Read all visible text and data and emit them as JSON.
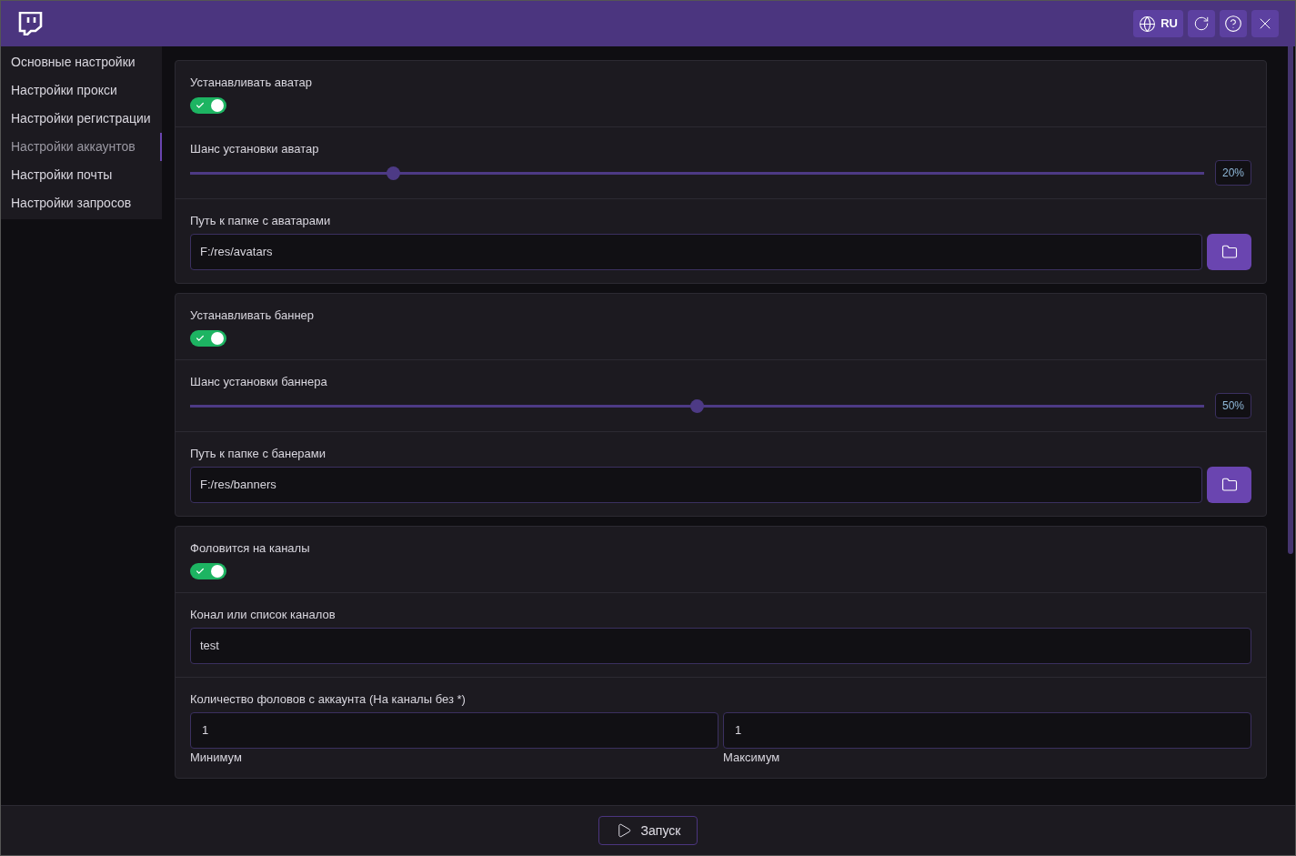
{
  "header": {
    "language": "RU"
  },
  "sidebar": {
    "items": [
      {
        "label": "Основные настройки",
        "selected": false
      },
      {
        "label": "Настройки прокси",
        "selected": false
      },
      {
        "label": "Настройки регистрации",
        "selected": false
      },
      {
        "label": "Настройки аккаунтов",
        "selected": true
      },
      {
        "label": "Настройки почты",
        "selected": false
      },
      {
        "label": "Настройки запросов",
        "selected": false
      }
    ]
  },
  "sections": [
    {
      "rows": [
        {
          "kind": "toggle",
          "label": "Устанавливать аватар",
          "on": true
        },
        {
          "kind": "slider",
          "label": "Шанс установки аватар",
          "level": 0.2,
          "reading": "20%"
        },
        {
          "kind": "path",
          "label": "Путь к папке с аватарами",
          "value": "F:/res/avatars"
        }
      ]
    },
    {
      "rows": [
        {
          "kind": "toggle",
          "label": "Устанавливать баннер",
          "on": true
        },
        {
          "kind": "slider",
          "label": "Шанс установки баннера",
          "level": 0.5,
          "reading": "50%"
        },
        {
          "kind": "path",
          "label": "Путь к папке с банерами",
          "value": "F:/res/banners"
        }
      ]
    },
    {
      "rows": [
        {
          "kind": "toggle",
          "label": "Фоловится на каналы",
          "on": true
        },
        {
          "kind": "text",
          "label": "Конал или список каналов",
          "value": "test"
        },
        {
          "kind": "range",
          "label": "Количество фоловов с аккаунта (На каналы без *)",
          "min": "1",
          "min_caption": "Минимум",
          "max": "1",
          "max_caption": "Максимум"
        }
      ]
    }
  ],
  "footer": {
    "start_button": "Запуск"
  }
}
